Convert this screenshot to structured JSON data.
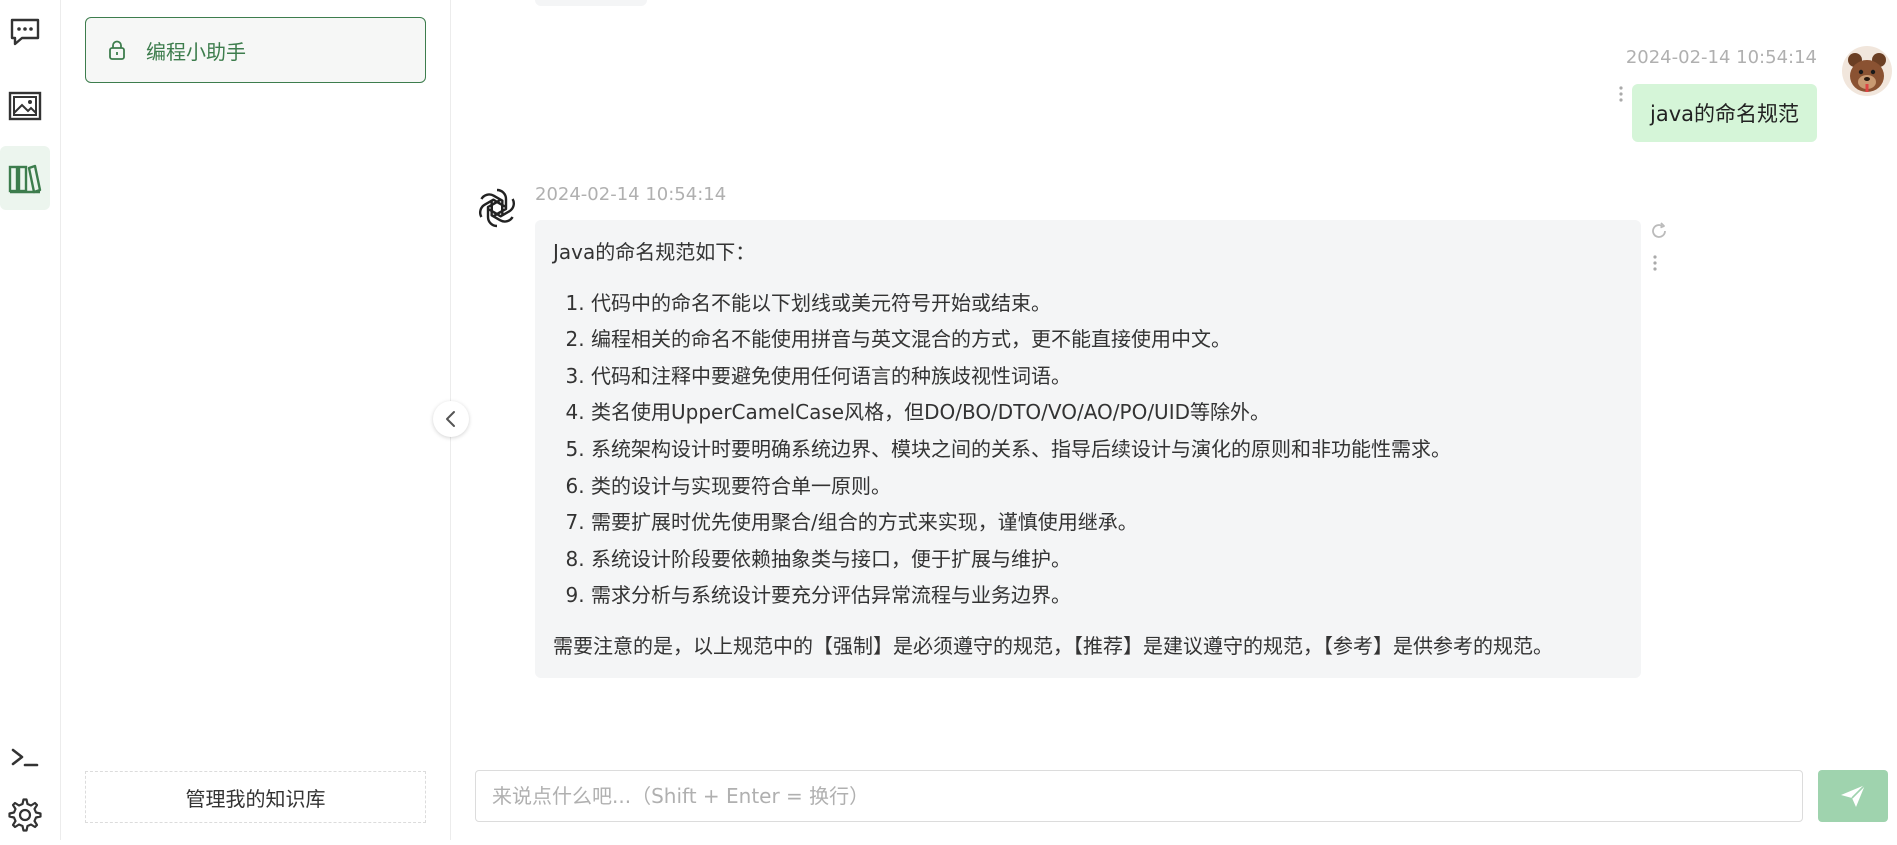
{
  "sidebar": {
    "nav_icons": [
      "chat-icon",
      "image-gallery-icon",
      "knowledge-base-icon"
    ],
    "bottom_icons": [
      "terminal-icon",
      "gear-icon"
    ],
    "active": "knowledge-base-icon",
    "accent_color": "#3d7d4d"
  },
  "knowledge": {
    "items": [
      {
        "label": "编程小助手",
        "icon": "lock-icon",
        "selected": true
      }
    ],
    "manage_label": "管理我的知识库"
  },
  "chat": {
    "user_message": {
      "time": "2024-02-14 10:54:14",
      "text": "java的命名规范",
      "bubble_color": "#d5f5d8"
    },
    "assistant_message": {
      "time": "2024-02-14 10:54:14",
      "intro": "Java的命名规范如下：",
      "items": [
        "代码中的命名不能以下划线或美元符号开始或结束。",
        "编程相关的命名不能使用拼音与英文混合的方式，更不能直接使用中文。",
        "代码和注释中要避免使用任何语言的种族歧视性词语。",
        "类名使用UpperCamelCase风格，但DO/BO/DTO/VO/AO/PO/UID等除外。",
        "系统架构设计时要明确系统边界、模块之间的关系、指导后续设计与演化的原则和非功能性需求。",
        "类的设计与实现要符合单一原则。",
        "需要扩展时优先使用聚合/组合的方式来实现，谨慎使用继承。",
        "系统设计阶段要依赖抽象类与接口，便于扩展与维护。",
        "需求分析与系统设计要充分评估异常流程与业务边界。"
      ],
      "note": "需要注意的是，以上规范中的【强制】是必须遵守的规范，【推荐】是建议遵守的规范，【参考】是供参考的规范。"
    },
    "input": {
      "placeholder": "来说点什么吧...（Shift + Enter = 换行）",
      "value": ""
    },
    "send_icon": "send-icon",
    "send_color": "#9fd3ae"
  }
}
